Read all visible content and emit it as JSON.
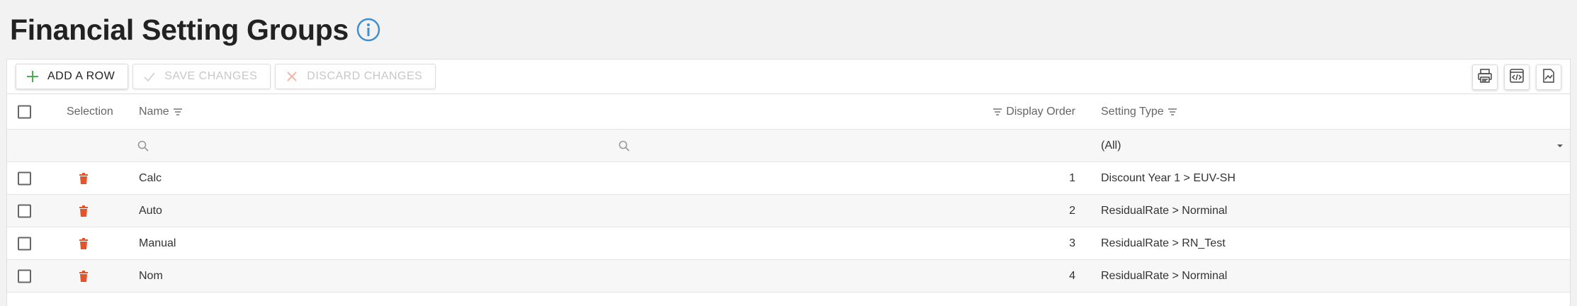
{
  "page": {
    "title": "Financial Setting Groups"
  },
  "toolbar": {
    "add_row": "Add a row",
    "save_changes": "Save changes",
    "discard_changes": "Discard changes"
  },
  "columns": {
    "selection": "Selection",
    "name": "Name",
    "display_order": "Display Order",
    "setting_type": "Setting Type"
  },
  "filters": {
    "setting_type": "(All)"
  },
  "rows": [
    {
      "name": "Calc",
      "display_order": "1",
      "setting_type": "Discount Year 1 > EUV-SH"
    },
    {
      "name": "Auto",
      "display_order": "2",
      "setting_type": "ResidualRate > Norminal"
    },
    {
      "name": "Manual",
      "display_order": "3",
      "setting_type": "ResidualRate > RN_Test"
    },
    {
      "name": "Nom",
      "display_order": "4",
      "setting_type": "ResidualRate > Norminal"
    }
  ],
  "icons": {
    "info": "info-icon",
    "add": "plus-icon",
    "save": "check-icon",
    "discard": "x-icon",
    "print": "print-icon",
    "export": "code-export-icon",
    "chart": "chart-icon",
    "filter": "filter-icon",
    "search": "search-icon",
    "delete": "trash-icon",
    "dropdown": "caret-down-icon"
  },
  "colors": {
    "info_blue": "#3f8fcf",
    "add_green": "#4caf50",
    "delete_orange": "#e4542a",
    "disabled_text": "#c8c8c8"
  }
}
